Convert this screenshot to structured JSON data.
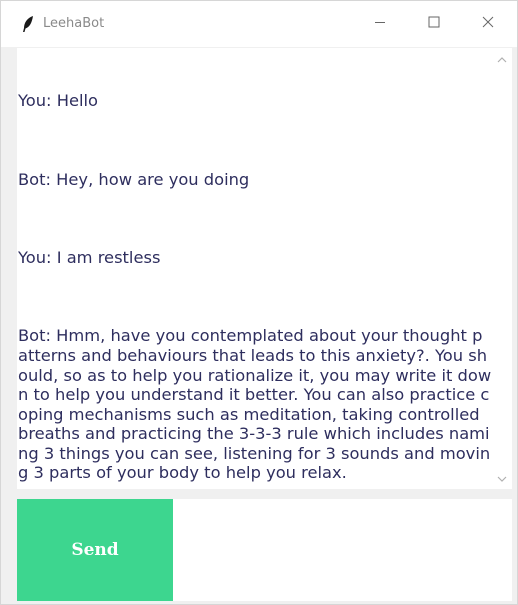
{
  "window": {
    "title": "LeehaBot"
  },
  "icons": {
    "app": "feather-icon",
    "minimize": "minimize-icon",
    "maximize": "maximize-icon",
    "close": "close-icon",
    "scroll_up": "chevron-up-icon",
    "scroll_down": "chevron-down-icon"
  },
  "chat": {
    "messages": [
      "You: Hello",
      "Bot: Hey, how are you doing",
      "You: I am restless",
      "Bot: Hmm, have you contemplated about your thought patterns and behaviours that leads to this anxiety?. You should, so as to help you rationalize it, you may write it down to help you understand it better. You can also practice coping mechanisms such as meditation, taking controlled breaths and practicing the 3-3-3 rule which includes naming 3 things you can see, listening for 3 sounds and moving 3 parts of your body to help you relax."
    ]
  },
  "send": {
    "label": "Send"
  },
  "entry": {
    "value": ""
  },
  "colors": {
    "send_button": "#3dd68f",
    "chat_text": "#2e2e5e",
    "title_text": "#8a8a8a"
  }
}
